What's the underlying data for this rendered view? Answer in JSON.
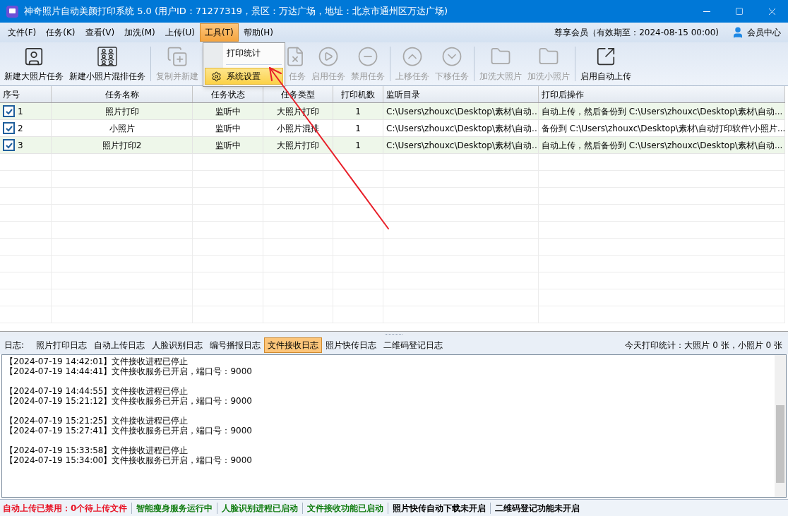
{
  "window": {
    "title": "神奇照片自动美颜打印系统 5.0 (用户ID：71277319，景区：万达广场，地址：北京市通州区万达广场)"
  },
  "menu_bar": {
    "items": [
      {
        "label": "文件(F)",
        "selected": false
      },
      {
        "label": "任务(K)",
        "selected": false
      },
      {
        "label": "查看(V)",
        "selected": false
      },
      {
        "label": "加洗(M)",
        "selected": false
      },
      {
        "label": "上传(U)",
        "selected": false
      },
      {
        "label": "工具(T)",
        "selected": true
      },
      {
        "label": "帮助(H)",
        "selected": false
      }
    ],
    "membership": "尊享会员（有效期至：2024-08-15 00:00)",
    "member_center": "会员中心"
  },
  "dropdown_menu": {
    "items": [
      {
        "label": "打印统计",
        "selected": false
      },
      {
        "label": "系统设置",
        "selected": true
      }
    ]
  },
  "toolbar": [
    {
      "kind": "portrait",
      "label": "新建大照片任务",
      "disabled": false
    },
    {
      "kind": "grid",
      "label": "新建小照片混排任务",
      "disabled": false
    },
    {
      "kind": "copy",
      "label": "复制并新建",
      "disabled": true
    },
    {
      "kind": "delete",
      "label": "任务",
      "disabled": true
    },
    {
      "kind": "play",
      "label": "启用任务",
      "disabled": true
    },
    {
      "kind": "minus",
      "label": "禁用任务",
      "disabled": true
    },
    {
      "kind": "up",
      "label": "上移任务",
      "disabled": true
    },
    {
      "kind": "down",
      "label": "下移任务",
      "disabled": true
    },
    {
      "kind": "folder",
      "label": "加洗大照片",
      "disabled": true
    },
    {
      "kind": "folder",
      "label": "加洗小照片",
      "disabled": true
    },
    {
      "kind": "upload",
      "label": "启用自动上传",
      "disabled": false
    }
  ],
  "table": {
    "columns": [
      "序号",
      "任务名称",
      "任务状态",
      "任务类型",
      "打印机数",
      "监听目录",
      "打印后操作"
    ],
    "rows": [
      {
        "checked": true,
        "cells": [
          "1",
          "照片打印",
          "监听中",
          "大照片打印",
          "1",
          "C:\\Users\\zhouxc\\Desktop\\素材\\自动...",
          "自动上传，然后备份到 C:\\Users\\zhouxc\\Desktop\\素材\\自动..."
        ]
      },
      {
        "checked": true,
        "cells": [
          "2",
          "小照片",
          "监听中",
          "小照片混排",
          "1",
          "C:\\Users\\zhouxc\\Desktop\\素材\\自动...",
          "备份到 C:\\Users\\zhouxc\\Desktop\\素材\\自动打印软件\\小照片..."
        ]
      },
      {
        "checked": true,
        "cells": [
          "3",
          "照片打印2",
          "监听中",
          "大照片打印",
          "1",
          "C:\\Users\\zhouxc\\Desktop\\素材\\自动...",
          "自动上传，然后备份到 C:\\Users\\zhouxc\\Desktop\\素材\\自动..."
        ]
      }
    ]
  },
  "log": {
    "label": "日志:",
    "tabs": [
      {
        "label": "照片打印日志",
        "selected": false
      },
      {
        "label": "自动上传日志",
        "selected": false
      },
      {
        "label": "人脸识别日志",
        "selected": false
      },
      {
        "label": "编号播报日志",
        "selected": false
      },
      {
        "label": "文件接收日志",
        "selected": true
      },
      {
        "label": "照片快传日志",
        "selected": false
      },
      {
        "label": "二维码登记日志",
        "selected": false
      }
    ],
    "today_stats": "今天打印统计：大照片 0 张，小照片 0 张",
    "groups": [
      [
        "【2024-07-19 14:42:01】文件接收进程已停止",
        "【2024-07-19 14:44:41】文件接收服务已开启，端口号：9000"
      ],
      [
        "【2024-07-19 14:44:55】文件接收进程已停止",
        "【2024-07-19 15:21:12】文件接收服务已开启，端口号：9000"
      ],
      [
        "【2024-07-19 15:21:25】文件接收进程已停止",
        "【2024-07-19 15:27:41】文件接收服务已开启，端口号：9000"
      ],
      [
        "【2024-07-19 15:33:58】文件接收进程已停止",
        "【2024-07-19 15:34:00】文件接收服务已开启，端口号：9000"
      ]
    ]
  },
  "status_bar": [
    {
      "text": "自动上传已禁用：0个待上传文件",
      "color": "#e81123"
    },
    {
      "text": "智能瘦身服务运行中",
      "color": "#107c10"
    },
    {
      "text": "人脸识别进程已启动",
      "color": "#107c10"
    },
    {
      "text": "文件接收功能已启动",
      "color": "#107c10"
    },
    {
      "text": "照片快传自动下载未开启",
      "color": "#000000"
    },
    {
      "text": "二维码登记功能未开启",
      "color": "#000000"
    }
  ]
}
